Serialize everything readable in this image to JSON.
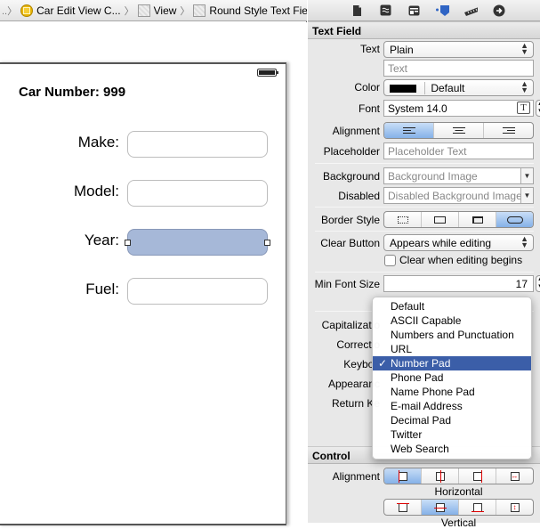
{
  "jumpbar": {
    "crumbs": [
      {
        "label": "Car Edit View C...",
        "icon": "view-controller-icon"
      },
      {
        "label": "View",
        "icon": "view-icon"
      },
      {
        "label": "Round Style Text Field",
        "icon": "view-icon"
      }
    ]
  },
  "canvas": {
    "title": "Car Number: 999",
    "fields": [
      {
        "label": "Make:",
        "value": "",
        "selected": false
      },
      {
        "label": "Model:",
        "value": "",
        "selected": false
      },
      {
        "label": "Year:",
        "value": "",
        "selected": true
      },
      {
        "label": "Fuel:",
        "value": "",
        "selected": false
      }
    ],
    "selection_color": "#a6b8d8"
  },
  "inspector": {
    "tabs": [
      "file-inspector-icon",
      "quick-help-icon",
      "identity-inspector-icon",
      "attributes-inspector-icon",
      "size-inspector-icon",
      "connections-inspector-icon"
    ],
    "active_tab": "attributes-inspector-icon",
    "text_field_section": {
      "header": "Text Field",
      "text_label": "Text",
      "text_value": "Plain",
      "text_content_placeholder": "Text",
      "color_label": "Color",
      "color_value": "Default",
      "color_swatch": "#000000",
      "font_label": "Font",
      "font_value": "System 14.0",
      "alignment_label": "Alignment",
      "alignment_selected": "left",
      "placeholder_label": "Placeholder",
      "placeholder_value": "Placeholder Text",
      "background_label": "Background",
      "background_value": "Background Image",
      "disabled_label": "Disabled",
      "disabled_value": "Disabled Background Image",
      "border_style_label": "Border Style",
      "border_style_selected": "rounded",
      "clear_button_label": "Clear Button",
      "clear_button_value": "Appears while editing",
      "clear_when_editing_label": "Clear when editing begins",
      "clear_when_editing_checked": false,
      "min_font_size_label": "Min Font Size",
      "min_font_size_value": "17",
      "capitalization_label": "Capitalizatio",
      "correction_label": "Correctio",
      "keyboard_label": "Keyboa",
      "appearance_label": "Appearanc",
      "return_key_label": "Return Ke"
    },
    "control_section": {
      "header": "Control",
      "alignment_label": "Alignment",
      "horizontal_label": "Horizontal",
      "horizontal_selected": 0,
      "vertical_label": "Vertical",
      "vertical_selected": 1
    }
  },
  "keyboard_menu": {
    "items": [
      "Default",
      "ASCII Capable",
      "Numbers and Punctuation",
      "URL",
      "Number Pad",
      "Phone Pad",
      "Name Phone Pad",
      "E-mail Address",
      "Decimal Pad",
      "Twitter",
      "Web Search"
    ],
    "selected": "Number Pad",
    "check_glyph": "✓",
    "highlight_color": "#3b5ea8"
  }
}
